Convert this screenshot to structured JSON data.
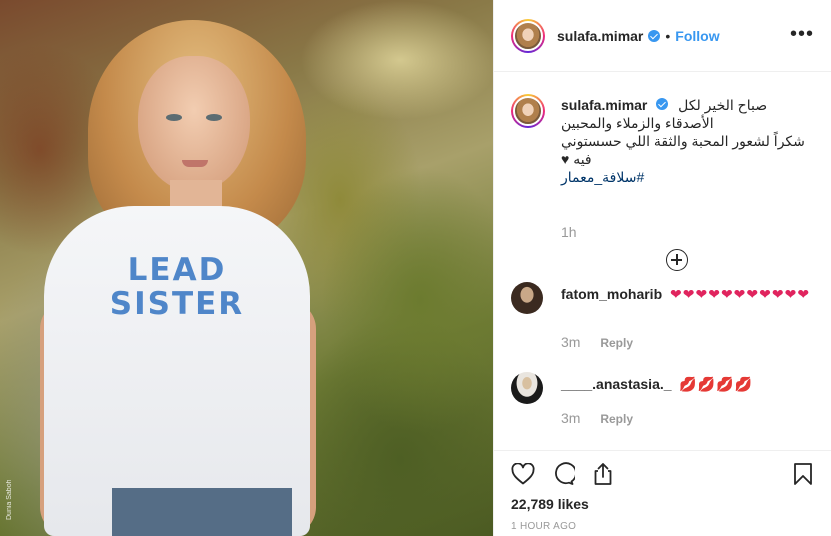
{
  "photo": {
    "shirt_line1": "LEAD",
    "shirt_line2": "SISTER",
    "watermark": "Dunia Saboh"
  },
  "header": {
    "username": "sulafa.mimar",
    "separator": "•",
    "follow_label": "Follow",
    "more_label": "•••",
    "verified": true
  },
  "caption": {
    "username": "sulafa.mimar",
    "lines": [
      "صباح الخير لكل",
      "الأصدقاء والزملاء والمحبين",
      "شكراً لشعور المحبة والثقة اللي حسستوني",
      "فيه ♥"
    ],
    "hashtag": "#سلافة_معمار",
    "time": "1h"
  },
  "comments": [
    {
      "username": "fatom_moharib",
      "text": "❤❤❤❤❤❤❤❤❤❤❤",
      "time": "3m",
      "reply_label": "Reply"
    },
    {
      "username": "____.anastasia._",
      "text": "💋💋💋💋",
      "time": "3m",
      "reply_label": "Reply"
    }
  ],
  "footer": {
    "likes": "22,789 likes",
    "posted_ago": "1 HOUR AGO"
  },
  "colors": {
    "accent": "#3897f0",
    "text": "#262626",
    "muted": "#999999",
    "heart": "#e0245e",
    "border": "#efefef"
  },
  "icons": [
    "heart-icon",
    "comment-icon",
    "share-icon",
    "bookmark-icon",
    "plus-circle-icon",
    "more-icon",
    "verified-badge-icon"
  ]
}
